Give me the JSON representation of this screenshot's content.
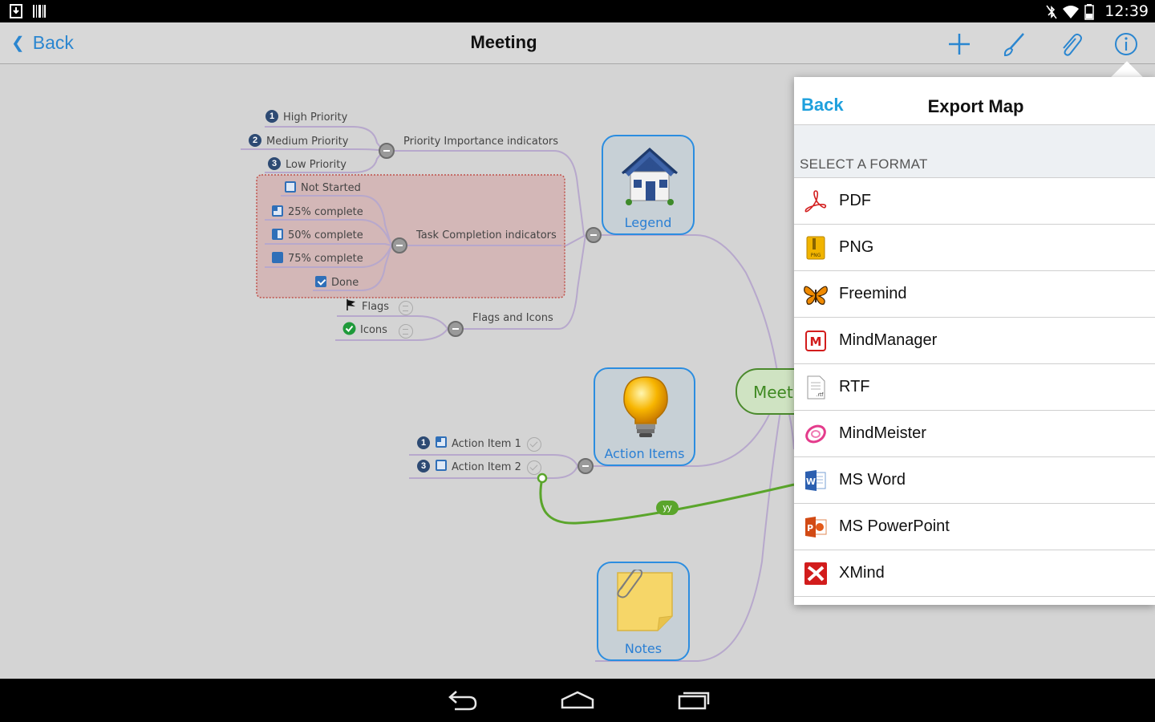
{
  "status_bar": {
    "time": "12:39"
  },
  "action_bar": {
    "back_label": "Back",
    "title": "Meeting",
    "tools": [
      "add-icon",
      "brush-icon",
      "paperclip-icon",
      "info-icon"
    ]
  },
  "mindmap": {
    "central_label": "Meeti",
    "nodes": {
      "legend": "Legend",
      "action_items": "Action Items",
      "notes": "Notes"
    },
    "branches": {
      "priority": "Priority Importance indicators",
      "task": "Task Completion indicators",
      "flags_icons": "Flags and Icons"
    },
    "priority_items": [
      {
        "num": "1",
        "label": "High Priority"
      },
      {
        "num": "2",
        "label": "Medium Priority"
      },
      {
        "num": "3",
        "label": "Low Priority"
      }
    ],
    "task_items": [
      "Not Started",
      "25% complete",
      "50% complete",
      "75% complete",
      "Done"
    ],
    "task_progress": [
      0,
      0.25,
      0.5,
      0.75,
      1
    ],
    "flag_items": [
      "Flags",
      "Icons"
    ],
    "action_items": [
      {
        "num": "1",
        "label": "Action Item 1"
      },
      {
        "num": "3",
        "label": "Action Item 2"
      }
    ],
    "link_label": "yy"
  },
  "export_panel": {
    "back_label": "Back",
    "title": "Export Map",
    "section_label": "SELECT A FORMAT",
    "formats": [
      {
        "label": "PDF",
        "icon": "pdf-icon"
      },
      {
        "label": "PNG",
        "icon": "png-icon"
      },
      {
        "label": "Freemind",
        "icon": "freemind-icon"
      },
      {
        "label": "MindManager",
        "icon": "mindmanager-icon"
      },
      {
        "label": "RTF",
        "icon": "rtf-icon"
      },
      {
        "label": "MindMeister",
        "icon": "mindmeister-icon"
      },
      {
        "label": "MS Word",
        "icon": "msword-icon"
      },
      {
        "label": "MS PowerPoint",
        "icon": "mspowerpoint-icon"
      },
      {
        "label": "XMind",
        "icon": "xmind-icon"
      }
    ]
  },
  "colors": {
    "accent_blue": "#2a86d0",
    "panel_back": "#1ea0dd",
    "central_green": "#4b8a2d",
    "task_highlight": "#d3adae"
  }
}
